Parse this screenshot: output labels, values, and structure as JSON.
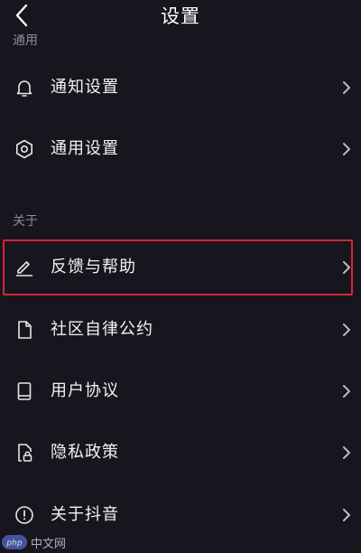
{
  "header": {
    "title": "设置",
    "back_icon": "chevron-left-icon"
  },
  "sections": {
    "general": {
      "label": "通用"
    },
    "about": {
      "label": "关于"
    }
  },
  "rows": [
    {
      "key": "notification",
      "label": "通知设置",
      "icon": "bell-icon"
    },
    {
      "key": "general",
      "label": "通用设置",
      "icon": "gear-icon"
    },
    {
      "key": "feedback",
      "label": "反馈与帮助",
      "icon": "pencil-icon"
    },
    {
      "key": "community",
      "label": "社区自律公约",
      "icon": "document-icon"
    },
    {
      "key": "agreement",
      "label": "用户协议",
      "icon": "book-icon"
    },
    {
      "key": "privacy",
      "label": "隐私政策",
      "icon": "lock-file-icon"
    },
    {
      "key": "about",
      "label": "关于抖音",
      "icon": "info-icon"
    }
  ],
  "colors": {
    "background": "#17161e",
    "text": "#f2f2f4",
    "secondary_text": "#8e8c96",
    "highlight_border": "#d3253c"
  },
  "watermark": {
    "logo_text": "php",
    "site_text": "中文网"
  }
}
